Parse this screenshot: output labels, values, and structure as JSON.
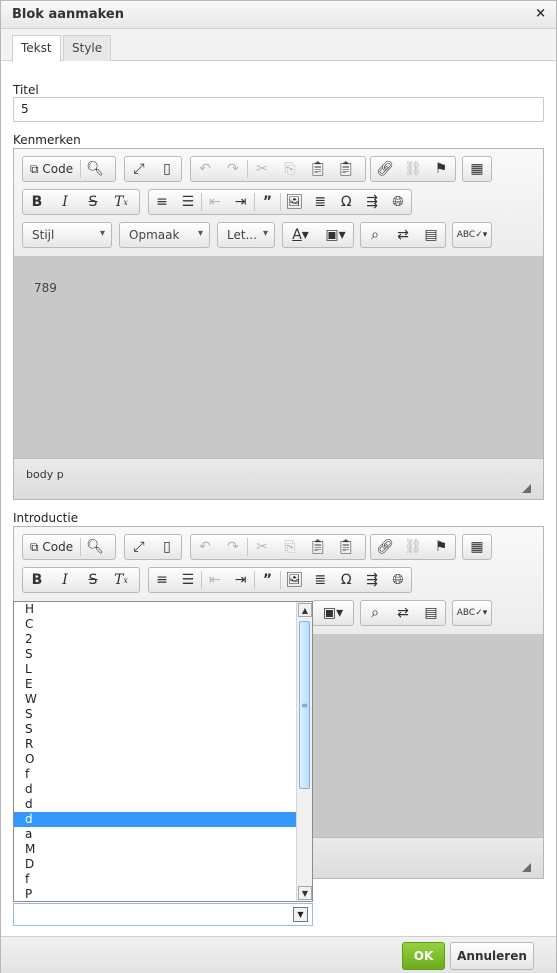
{
  "dialog": {
    "title": "Blok aanmaken",
    "close_glyph": "×"
  },
  "tabs": [
    {
      "label": "Tekst"
    },
    {
      "label": "Style"
    }
  ],
  "form": {
    "title_label": "Titel",
    "title_value": "5",
    "features_label": "Kenmerken",
    "intro_label": "Introductie"
  },
  "toolbar": {
    "code_label": "Code",
    "format_labels": [
      "Stijl",
      "Opmaak",
      "Let..."
    ]
  },
  "editor1": {
    "content": "789",
    "path": "body  p"
  },
  "dropdown": {
    "items": [
      "H",
      "C",
      "2",
      "S",
      "L",
      "E",
      "W",
      "S",
      "S",
      "R",
      "O",
      "f",
      "d",
      "d",
      "d",
      "a",
      "M",
      "D",
      "f",
      "P"
    ],
    "selected_index": 14,
    "select_value": ""
  },
  "footer": {
    "ok_label": "OK",
    "cancel_label": "Annuleren"
  },
  "colors": {
    "ok_green": "#7ab92d",
    "selection_blue": "#3399ff",
    "editor_gray": "#c8c8c8"
  }
}
